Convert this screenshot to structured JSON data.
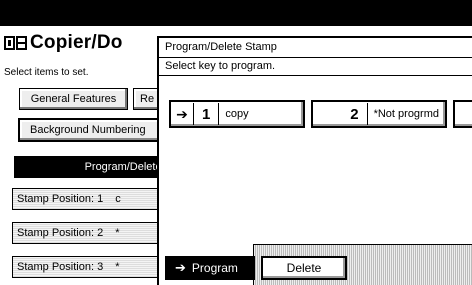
{
  "app": {
    "title": "Copier/Do",
    "instruction": "Select items to set."
  },
  "tabs": [
    {
      "label": "General Features"
    },
    {
      "label": "Re"
    }
  ],
  "background_numbering": {
    "label": "Background Numbering"
  },
  "selected_item": {
    "label": "Program/Delete S"
  },
  "stamp_positions": [
    {
      "label": "Stamp Position: 1",
      "value": "c"
    },
    {
      "label": "Stamp Position: 2",
      "value": "*"
    },
    {
      "label": "Stamp Position: 3",
      "value": "*"
    }
  ],
  "dialog": {
    "title": "Program/Delete Stamp",
    "subtitle": "Select key to program.",
    "keys": [
      {
        "number": "1",
        "label": "copy",
        "icon": "enter-arrow-icon"
      },
      {
        "number": "2",
        "label": "*Not progrmd"
      }
    ],
    "program_button": "Program",
    "delete_button": "Delete"
  }
}
